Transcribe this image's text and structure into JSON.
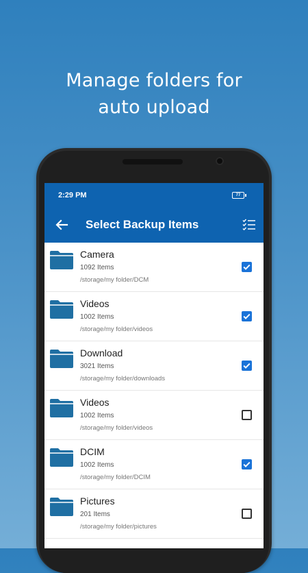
{
  "headline": {
    "line1": "Manage folders for",
    "line2": "auto upload"
  },
  "status_bar": {
    "time": "2:29 PM",
    "battery": "77"
  },
  "app_bar": {
    "title": "Select Backup Items",
    "back_icon": "arrow-back-icon",
    "action_icon": "checklist-icon"
  },
  "colors": {
    "accent": "#0e63b0",
    "checkbox": "#1a73d8",
    "folder": "#1f6fa3"
  },
  "items": [
    {
      "name": "Camera",
      "count": "1092 Items",
      "path": "/storage/my folder/DCM",
      "checked": true
    },
    {
      "name": "Videos",
      "count": "1002 Items",
      "path": "/storage/my folder/videos",
      "checked": true
    },
    {
      "name": "Download",
      "count": "3021 Items",
      "path": "/storage/my folder/downloads",
      "checked": true
    },
    {
      "name": "Videos",
      "count": "1002 Items",
      "path": "/storage/my folder/videos",
      "checked": false
    },
    {
      "name": "DCIM",
      "count": "1002 Items",
      "path": "/storage/my folder/DCIM",
      "checked": true
    },
    {
      "name": "Pictures",
      "count": "201 Items",
      "path": "/storage/my folder/pictures",
      "checked": false
    }
  ]
}
